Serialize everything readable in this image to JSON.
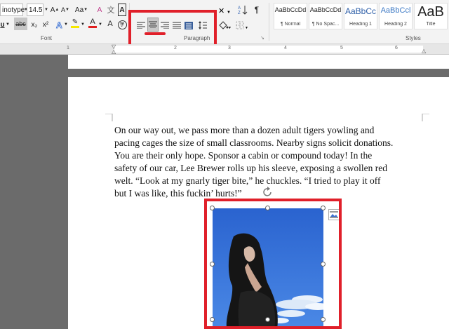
{
  "font": {
    "font_name": "inotype",
    "font_size": "14.5",
    "grow_font": "A",
    "shrink_font": "A",
    "change_case": "Aa",
    "clear_format": "A",
    "subscript": "x₂",
    "superscript": "x²",
    "font_color": "A",
    "char_shading": "A",
    "group_label": "Font"
  },
  "paragraph": {
    "group_label": "Paragraph"
  },
  "styles": {
    "group_label": "Styles",
    "items": [
      {
        "sample": "AaBbCcDd",
        "name": "¶ Normal"
      },
      {
        "sample": "AaBbCcDd",
        "name": "¶ No Spac..."
      },
      {
        "sample": "AaBbCc",
        "name": "Heading 1"
      },
      {
        "sample": "AaBbCcl",
        "name": "Heading 2"
      },
      {
        "sample": "AaB",
        "name": "Title"
      }
    ]
  },
  "ruler": {
    "numbers": [
      "1",
      "2",
      "3",
      "4",
      "5",
      "6"
    ]
  },
  "document": {
    "paragraph_lines": [
      "On our way out, we pass more than a dozen adult tigers yowling and",
      "pacing cages the size of small classrooms. Nearby signs solicit donations.",
      "You are their only hope. Sponsor a cabin or compound today! In the",
      "safety of our car, Lee Brewer rolls up his sleeve, exposing a swollen red",
      "welt. “Look at my gnarly tiger bite,” he chuckles. “I tried to play it off",
      "but I was like, this fuckin’ hurts!”"
    ]
  },
  "colors": {
    "highlight_red": "#e0202a",
    "sky_blue": "#2f6fd6",
    "font_color_bar": "#e02020",
    "highlight_bar": "#f5e800"
  }
}
